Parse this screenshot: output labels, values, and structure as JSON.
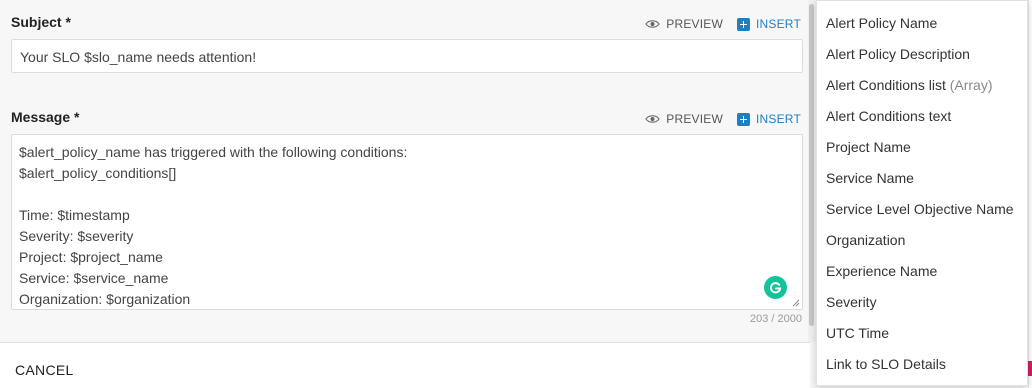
{
  "subject": {
    "label": "Subject *",
    "preview_label": "PREVIEW",
    "insert_label": "INSERT",
    "value": "Your SLO $slo_name needs attention!"
  },
  "message": {
    "label": "Message *",
    "preview_label": "PREVIEW",
    "insert_label": "INSERT",
    "lines": [
      "$alert_policy_name has triggered with the following conditions:",
      "$alert_policy_conditions[]",
      "",
      "Time: $timestamp",
      "Severity: $severity",
      "Project: $project_name",
      "Service: $service_name",
      "Organization: $organization"
    ],
    "counter": "203 / 2000"
  },
  "footer": {
    "cancel_label": "CANCEL"
  },
  "insert_menu": {
    "items": [
      {
        "label": "Alert Policy Name",
        "hint": ""
      },
      {
        "label": "Alert Policy Description",
        "hint": ""
      },
      {
        "label": "Alert Conditions list",
        "hint": "(Array)"
      },
      {
        "label": "Alert Conditions text",
        "hint": ""
      },
      {
        "label": "Project Name",
        "hint": ""
      },
      {
        "label": "Service Name",
        "hint": ""
      },
      {
        "label": "Service Level Objective Name",
        "hint": ""
      },
      {
        "label": "Organization",
        "hint": ""
      },
      {
        "label": "Experience Name",
        "hint": ""
      },
      {
        "label": "Severity",
        "hint": ""
      },
      {
        "label": "UTC Time",
        "hint": ""
      },
      {
        "label": "Link to SLO Details",
        "hint": ""
      }
    ]
  },
  "colors": {
    "accent": "#1e7fc1",
    "grammarly": "#15c39a",
    "pink": "#d81b60"
  }
}
